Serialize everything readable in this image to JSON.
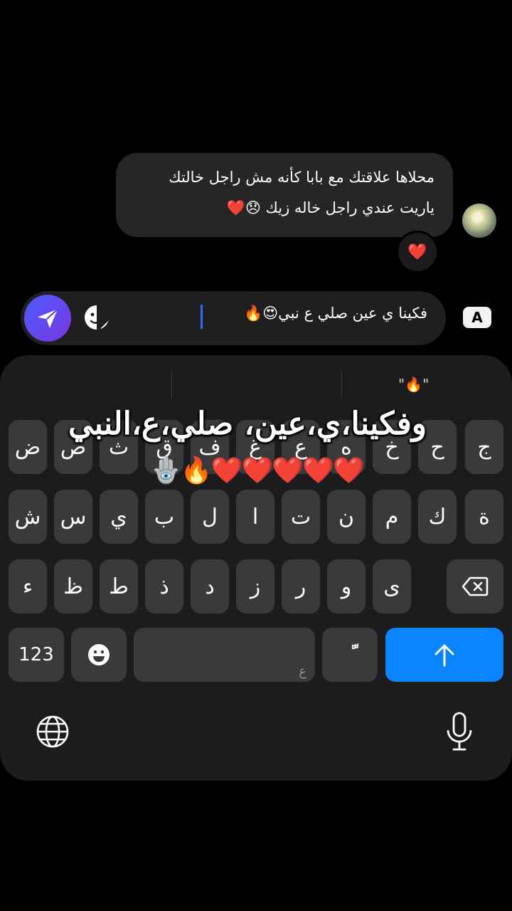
{
  "chat": {
    "incoming": {
      "line1": "محلاها علاقتك مع بابا كأنه مش راجل خالتك",
      "line2": "ياريت عندي راجل خاله زيك 😞❤️"
    },
    "reaction": "❤️"
  },
  "compose": {
    "text": "فكينا ي عين صلي ع نبي😍🔥",
    "language_badge": "A"
  },
  "keyboard": {
    "suggestion": "\"🔥\"",
    "rows": [
      [
        "ض",
        "ص",
        "ث",
        "ق",
        "ف",
        "غ",
        "ع",
        "ه",
        "خ",
        "ح",
        "ج"
      ],
      [
        "ش",
        "س",
        "ي",
        "ب",
        "ل",
        "ا",
        "ت",
        "ن",
        "م",
        "ك",
        "ة"
      ],
      [
        "ء",
        "ظ",
        "ط",
        "ذ",
        "د",
        "ز",
        "ر",
        "و",
        "ى"
      ]
    ],
    "numbers_label": "123",
    "space_hint": "ع",
    "tashkeel_label": "ًّ"
  },
  "overlay": {
    "caption": "وفكينا،ي،عين، صلي،ع،النبي",
    "emojis": "🪬🔥❤️❤️❤️❤️❤️"
  },
  "colors": {
    "accent_blue": "#0a84ff",
    "send_gradient": "#4a5cff",
    "key": "#3a3a3c",
    "keyboard_bg": "#1c1c1e",
    "bubble": "#262626"
  }
}
